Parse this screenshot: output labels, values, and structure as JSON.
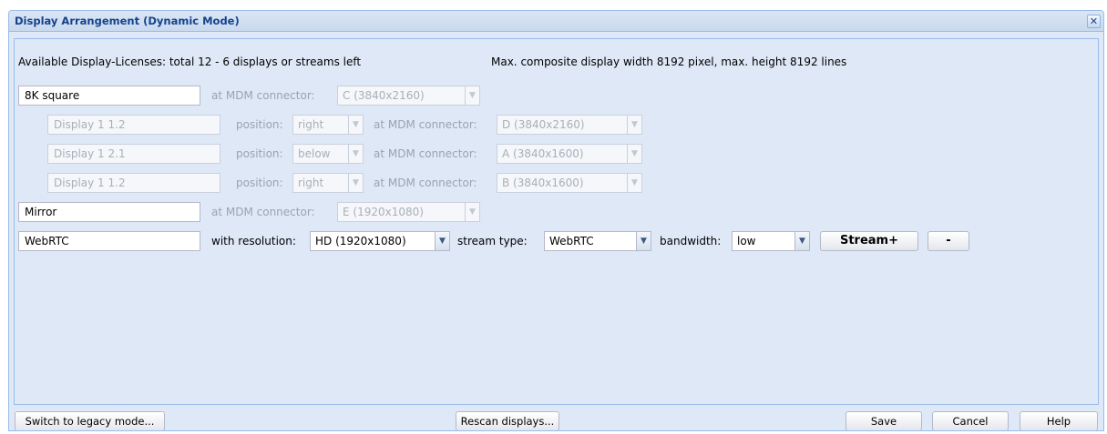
{
  "dialog": {
    "title": "Display Arrangement (Dynamic Mode)",
    "close_symbol": "✕"
  },
  "info": {
    "licenses": "Available Display-Licenses: total 12 - 6 displays or streams left",
    "max_size": "Max. composite display width 8192 pixel, max. height 8192 lines"
  },
  "labels": {
    "at_mdm_connector": "at MDM connector:",
    "position": "position:",
    "with_resolution": "with resolution:",
    "stream_type": "stream type:",
    "bandwidth": "bandwidth:"
  },
  "rows": {
    "group1": {
      "name": "8K square",
      "connector": "C (3840x2160)"
    },
    "sub1": {
      "name": "Display 1  1.2",
      "position": "right",
      "connector": "D (3840x2160)"
    },
    "sub2": {
      "name": "Display 1  2.1",
      "position": "below",
      "connector": "A (3840x1600)"
    },
    "sub3": {
      "name": "Display 1  1.2",
      "position": "right",
      "connector": "B (3840x1600)"
    },
    "mirror": {
      "name": "Mirror",
      "connector": "E (1920x1080)"
    },
    "stream": {
      "name": "WebRTC",
      "resolution": "HD (1920x1080)",
      "stream_type": "WebRTC",
      "bandwidth": "low",
      "add_label": "Stream+",
      "remove_label": "-"
    }
  },
  "footer": {
    "legacy_label": "Switch to legacy mode...",
    "rescan_label": "Rescan displays...",
    "save_label": "Save",
    "cancel_label": "Cancel",
    "help_label": "Help"
  },
  "icons": {
    "dropdown": "chevron-down-icon",
    "close": "close-icon"
  },
  "colors": {
    "title_text": "#15428b",
    "panel_bg": "#dfe8f6",
    "border": "#99bbe8"
  }
}
